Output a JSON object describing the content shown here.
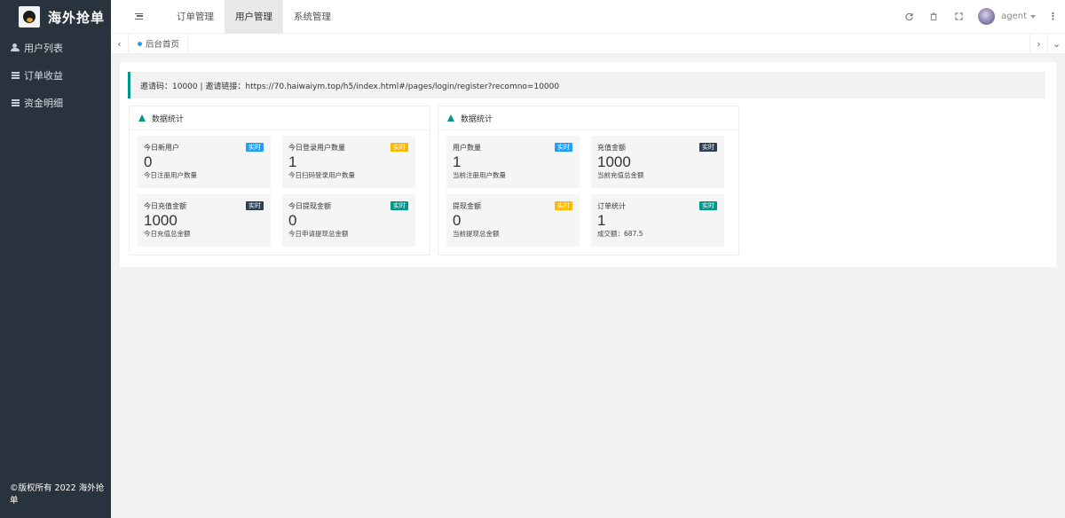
{
  "app": {
    "title": "海外抢单",
    "copyright": "©版权所有 2022 海外抢单"
  },
  "sidebar": {
    "items": [
      {
        "label": "用户列表",
        "icon": "users-icon"
      },
      {
        "label": "订单收益",
        "icon": "list-icon"
      },
      {
        "label": "资金明细",
        "icon": "list-icon"
      }
    ]
  },
  "header": {
    "tabs": [
      {
        "label": "订单管理"
      },
      {
        "label": "用户管理",
        "active": true
      },
      {
        "label": "系统管理"
      }
    ],
    "icons": [
      "refresh-icon",
      "trash-icon",
      "fullscreen-icon"
    ],
    "user_name": "agent"
  },
  "tabbar": {
    "home_tab": "后台首页"
  },
  "invite": {
    "text": "邀请码：10000 | 邀请链接：https://70.haiwaiym.top/h5/index.html#/pages/login/register?recomno=10000"
  },
  "panels": [
    {
      "title": "数据统计",
      "stats": [
        {
          "title": "今日新用户",
          "value": "0",
          "desc": "今日注册用户数量",
          "badge": "实时",
          "badge_color": "#1e9fff"
        },
        {
          "title": "今日登录用户数量",
          "value": "1",
          "desc": "今日扫码登录用户数量",
          "badge": "实时",
          "badge_color": "#ffb800"
        },
        {
          "title": "今日充值金额",
          "value": "1000",
          "desc": "今日充值总金额",
          "badge": "实时",
          "badge_color": "#2f4056"
        },
        {
          "title": "今日提现金额",
          "value": "0",
          "desc": "今日申请提现总金额",
          "badge": "实时",
          "badge_color": "#009688"
        }
      ]
    },
    {
      "title": "数据统计",
      "stats": [
        {
          "title": "用户数量",
          "value": "1",
          "desc": "当前注册用户数量",
          "badge": "实时",
          "badge_color": "#1e9fff"
        },
        {
          "title": "充值金额",
          "value": "1000",
          "desc": "当前充值总金额",
          "badge": "实时",
          "badge_color": "#2f4056"
        },
        {
          "title": "提现金额",
          "value": "0",
          "desc": "当前提现总金额",
          "badge": "实时",
          "badge_color": "#ffb800"
        },
        {
          "title": "订单统计",
          "value": "1",
          "desc": "成交额：687.5",
          "badge": "实时",
          "badge_color": "#009688"
        }
      ]
    }
  ]
}
